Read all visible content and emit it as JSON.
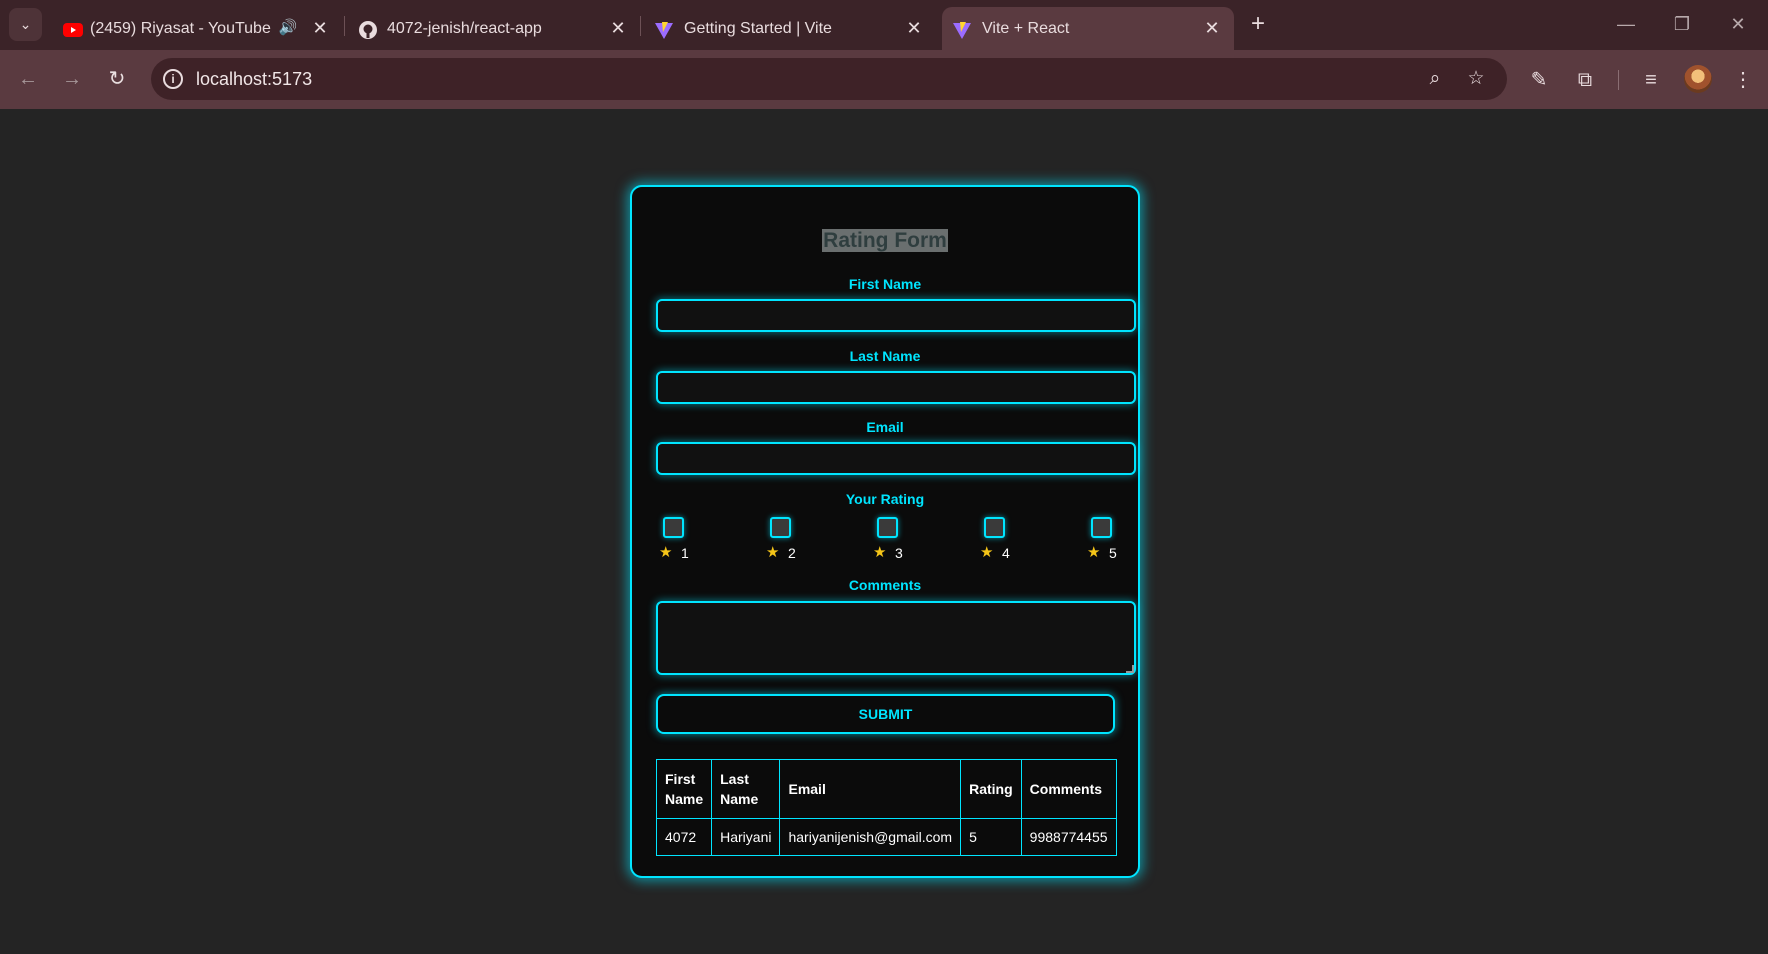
{
  "browser": {
    "tabs": [
      {
        "title": "(2459) Riyasat - YouTube",
        "icon": "youtube-icon"
      },
      {
        "title": "4072-jenish/react-app",
        "icon": "github-icon"
      },
      {
        "title": "Getting Started | Vite",
        "icon": "vite-icon"
      },
      {
        "title": "Vite + React",
        "icon": "vite-icon",
        "active": true
      }
    ],
    "url": "localhost:5173"
  },
  "form": {
    "title": "Rating Form",
    "first_name_label": "First Name",
    "last_name_label": "Last Name",
    "email_label": "Email",
    "first_name_value": "",
    "last_name_value": "",
    "email_value": "",
    "rating_label": "Your Rating",
    "ratings": [
      "1",
      "2",
      "3",
      "4",
      "5"
    ],
    "comments_label": "Comments",
    "comments_value": "",
    "submit_label": "SUBMIT"
  },
  "table": {
    "headers": [
      "First Name",
      "Last Name",
      "Email",
      "Rating",
      "Comments"
    ],
    "rows": [
      [
        "4072",
        "Hariyani",
        "hariyanijenish@gmail.com",
        "5",
        "9988774455"
      ]
    ]
  },
  "colors": {
    "accent": "#00e5ff",
    "page_bg": "#242424",
    "card_bg": "#0b0b0b",
    "star": "#f5c518"
  }
}
